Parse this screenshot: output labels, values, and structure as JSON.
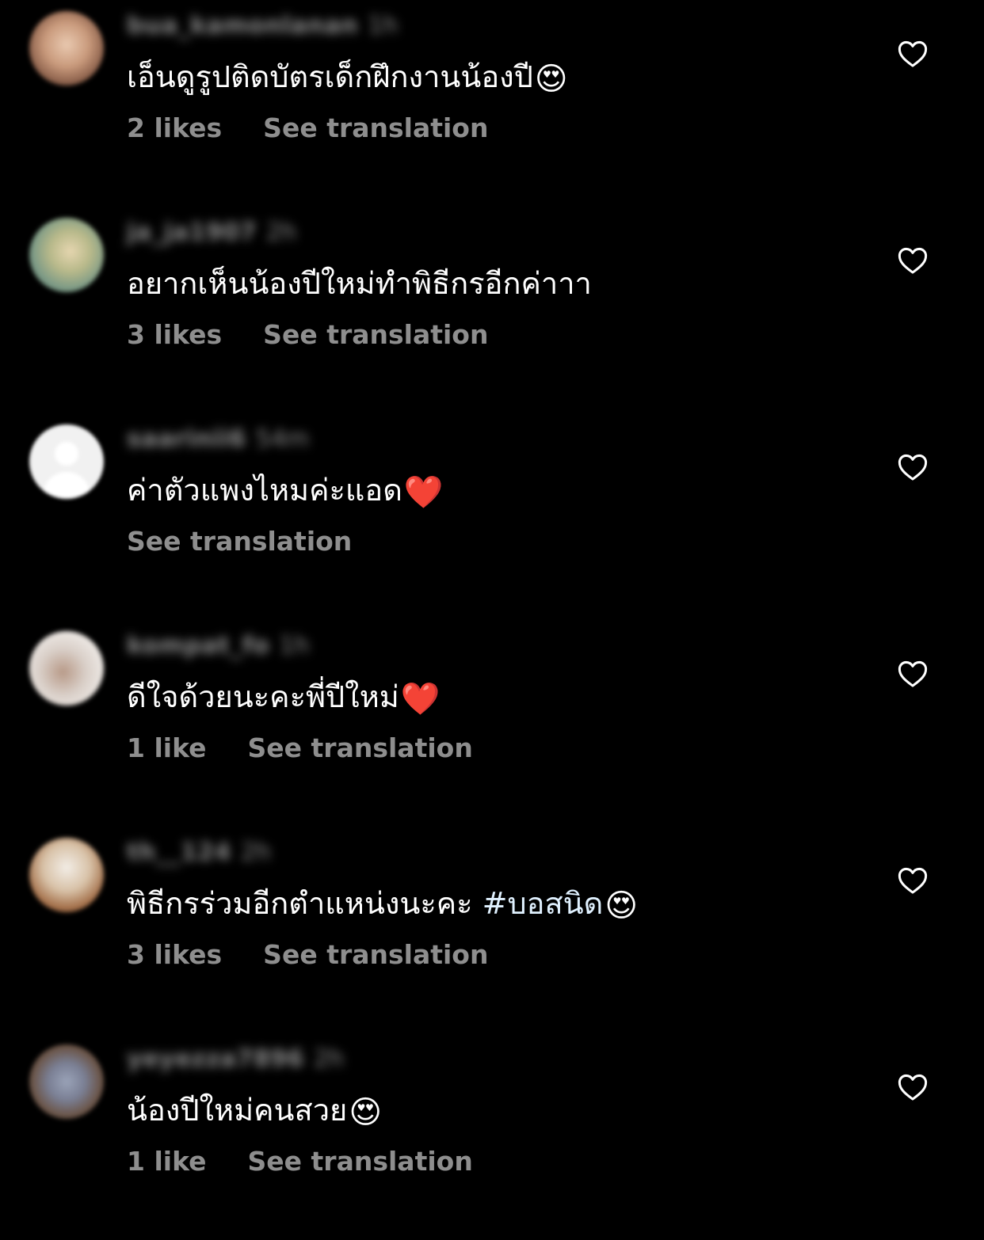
{
  "colors": {
    "background": "#000000",
    "text_primary": "#ffffff",
    "text_secondary": "#8e8e8e",
    "hashtag": "#e0f1ff",
    "heart_emoji": "#e0242e"
  },
  "comments": [
    {
      "username": "bua_kamonlanan",
      "time": "1h",
      "text": "เอ็นดูรูปติดบัตรเด็กฝึกงานน้องปี",
      "emoji": "😍",
      "likes": "2 likes",
      "translate_label": "See translation",
      "avatar": "photo"
    },
    {
      "username": "ja_ja1907",
      "time": "2h",
      "text": "อยากเห็นน้องปีใหม่ทำพิธีกรอีกค่าาา",
      "emoji": "",
      "likes": "3 likes",
      "translate_label": "See translation",
      "avatar": "photo"
    },
    {
      "username": "saarinii6",
      "time": "54m",
      "text": "ค่าตัวแพงไหมค่ะแอด",
      "emoji": "❤️",
      "likes": "",
      "translate_label": "See translation",
      "avatar": "default"
    },
    {
      "username": "kompat_fo",
      "time": "1h",
      "text": "ดีใจด้วยนะคะพี่ปีใหม่",
      "emoji": "❤️",
      "likes": "1 like",
      "translate_label": "See translation",
      "avatar": "photo"
    },
    {
      "username": "th__124",
      "time": "2h",
      "text": "พิธีกรร่วมอีกตำแหน่งนะคะ ",
      "hashtag": "#บอสนิด",
      "emoji": "😍",
      "likes": "3 likes",
      "translate_label": "See translation",
      "avatar": "photo"
    },
    {
      "username": "yeyezza7896",
      "time": "2h",
      "text": "น้องปีใหม่คนสวย",
      "emoji": "😍",
      "likes": "1 like",
      "translate_label": "See translation",
      "avatar": "photo"
    }
  ],
  "icons": {
    "like": "heart-outline-icon",
    "default_avatar": "person-silhouette-icon"
  }
}
